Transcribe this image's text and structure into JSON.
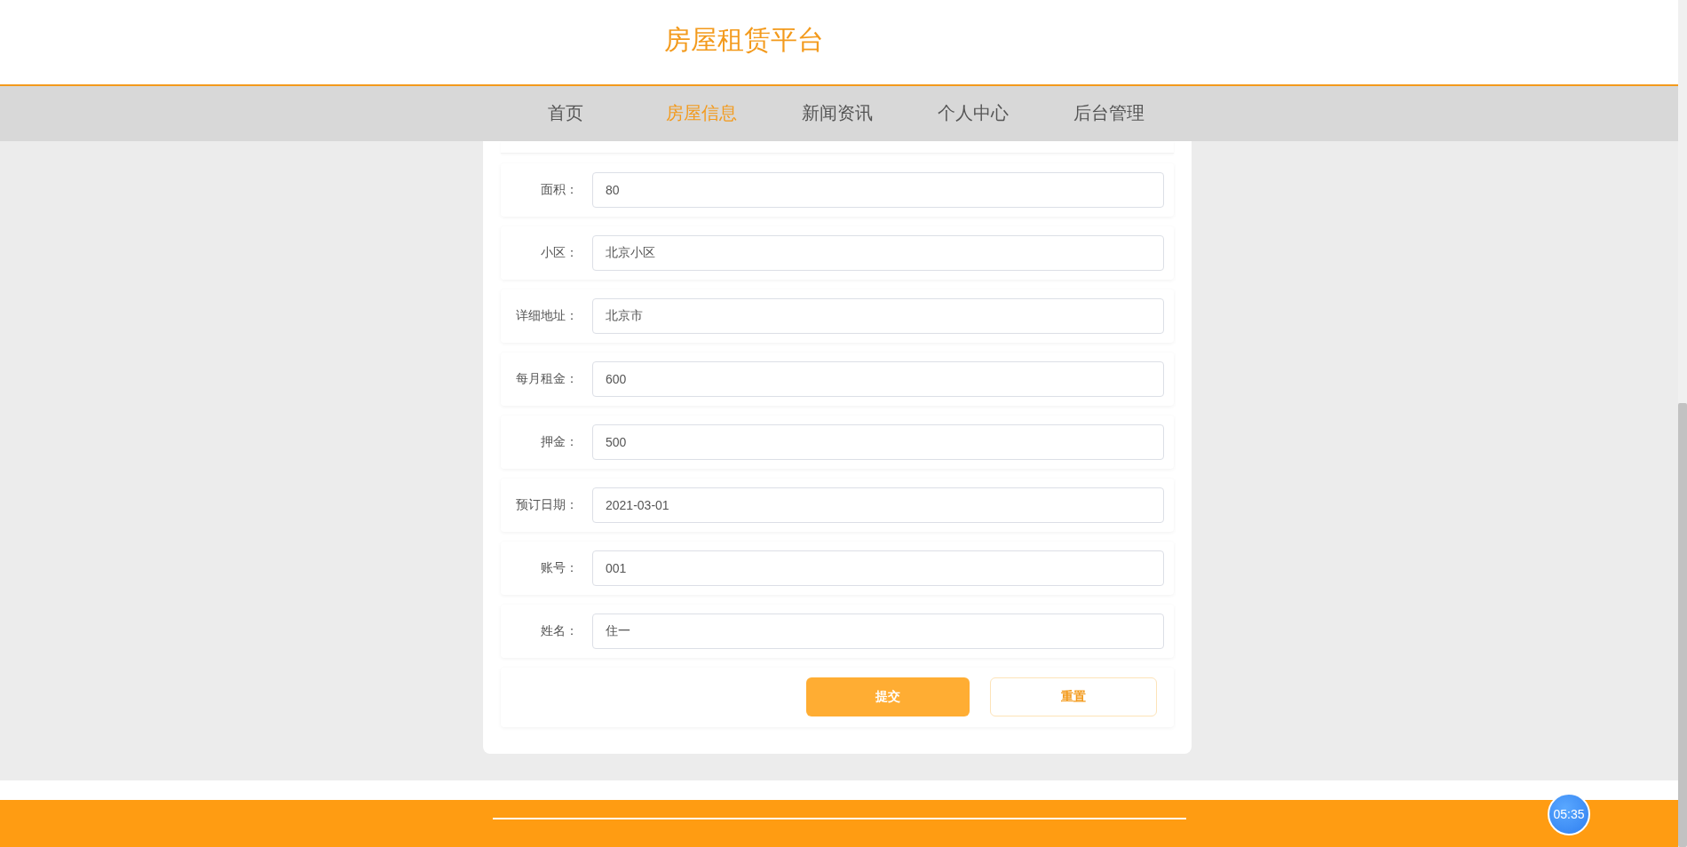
{
  "site_title": "房屋租赁平台",
  "nav": [
    {
      "label": "首页",
      "selected": false
    },
    {
      "label": "房屋信息",
      "selected": true
    },
    {
      "label": "新闻资讯",
      "selected": false
    },
    {
      "label": "个人中心",
      "selected": false
    },
    {
      "label": "后台管理",
      "selected": false
    }
  ],
  "form": {
    "fields": [
      {
        "label": "面积：",
        "value": "80"
      },
      {
        "label": "小区：",
        "value": "北京小区"
      },
      {
        "label": "详细地址：",
        "value": "北京市"
      },
      {
        "label": "每月租金：",
        "value": "600"
      },
      {
        "label": "押金：",
        "value": "500"
      },
      {
        "label": "预订日期：",
        "value": "2021-03-01"
      },
      {
        "label": "账号：",
        "value": "001"
      },
      {
        "label": "姓名：",
        "value": "住一"
      }
    ],
    "buttons": [
      {
        "label": "提交",
        "kind": "primary"
      },
      {
        "label": "重置",
        "kind": "secondary"
      }
    ]
  },
  "timer": "05:35"
}
